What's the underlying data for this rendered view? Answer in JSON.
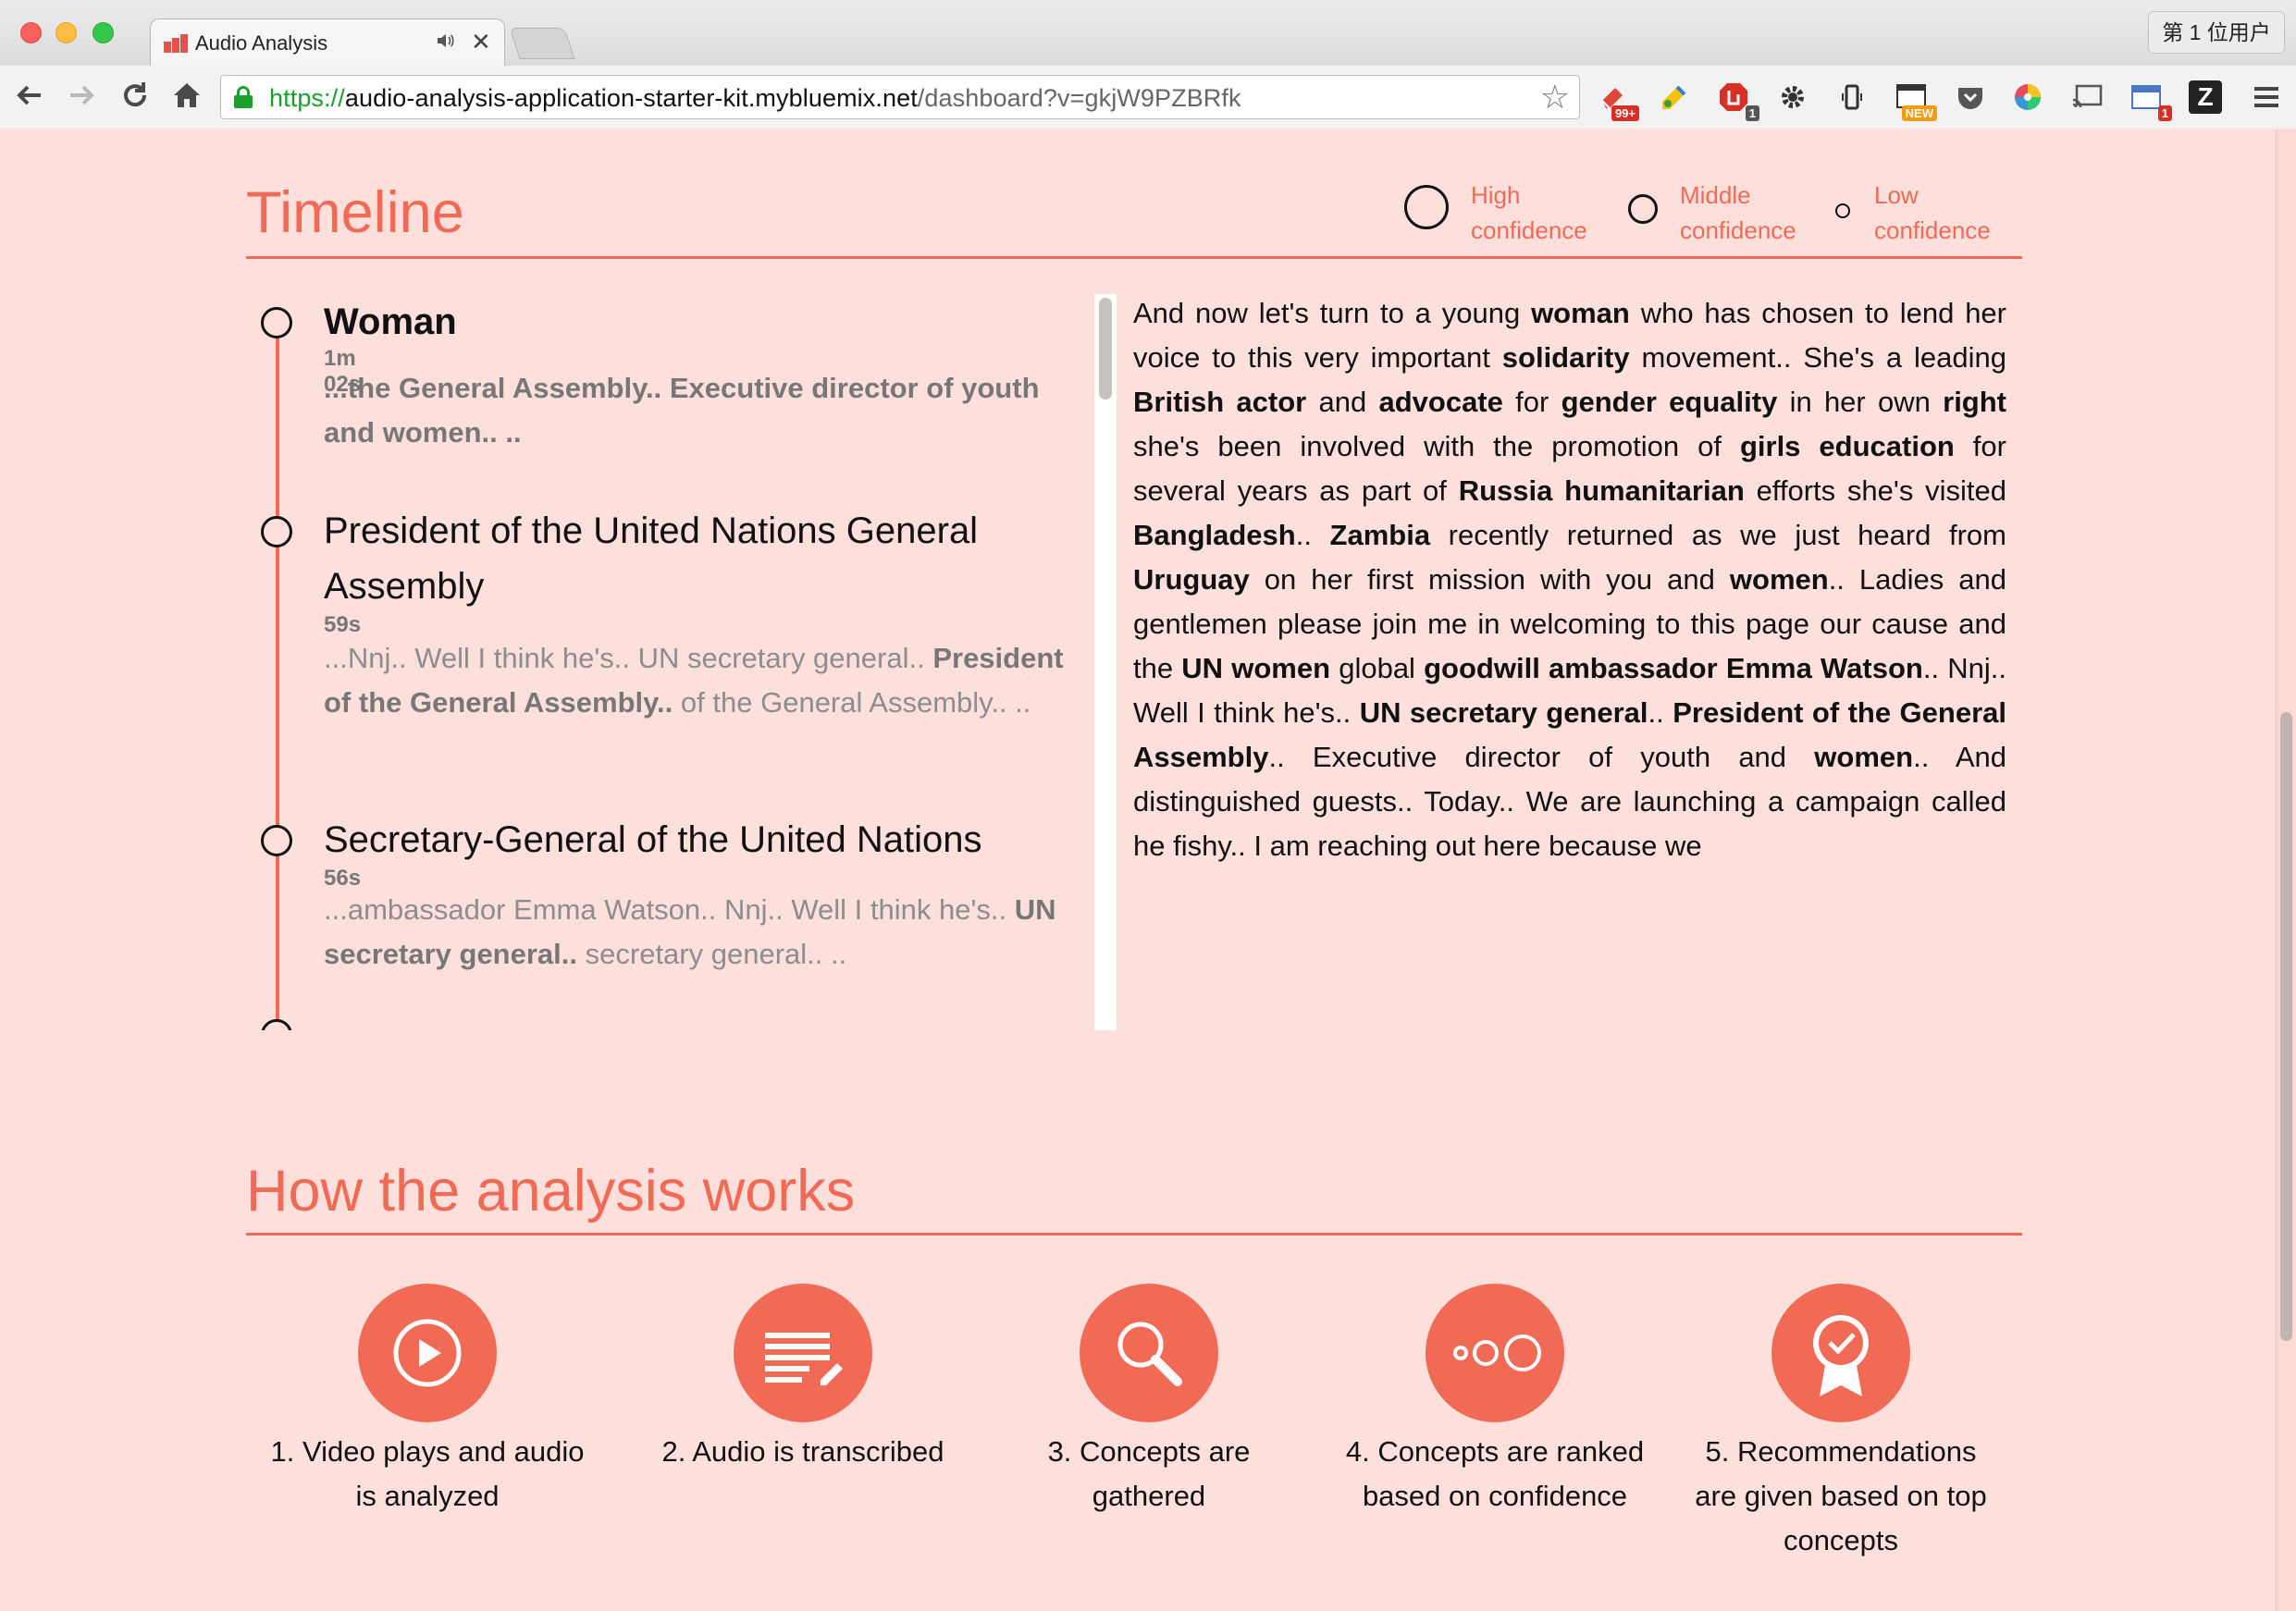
{
  "browser": {
    "tab_title": "Audio Analysis",
    "tab_audio_icon": "speaker-icon",
    "tab_close": "✕",
    "profile_label": "第 1 位用户",
    "url": {
      "scheme": "https://",
      "host": "audio-analysis-application-starter-kit.mybluemix.net",
      "path": "/dashboard?v=gkjW9PZBRfk"
    },
    "extensions": [
      {
        "name": "eraser-extension-icon",
        "badge": "99+"
      },
      {
        "name": "pencil-extension-icon",
        "badge": ""
      },
      {
        "name": "adblock-extension-icon",
        "badge": "1"
      },
      {
        "name": "gear-extension-icon",
        "badge": ""
      },
      {
        "name": "phone-extension-icon",
        "badge": ""
      },
      {
        "name": "window-extension-icon",
        "badge": "NEW"
      },
      {
        "name": "pocket-extension-icon",
        "badge": ""
      },
      {
        "name": "color-wheel-extension-icon",
        "badge": ""
      },
      {
        "name": "cast-extension-icon",
        "badge": ""
      },
      {
        "name": "calendar-extension-icon",
        "badge": "1"
      },
      {
        "name": "z-extension-icon",
        "badge": ""
      },
      {
        "name": "menu-icon",
        "badge": ""
      }
    ]
  },
  "timeline": {
    "title": "Timeline",
    "legend": [
      {
        "label": "High confidence"
      },
      {
        "label": "Middle confidence"
      },
      {
        "label": "Low confidence"
      }
    ],
    "entries": [
      {
        "heading": "Woman",
        "duration": "1m 02s",
        "snippet": "...the General Assembly.. Executive director of youth and women.. .."
      },
      {
        "heading": "President of the United Nations General Assembly",
        "duration": "59s",
        "snippet_plain_1": "...Nnj.. Well I think he's.. UN secretary general..",
        "snippet_bold": "President of the General Assembly..",
        "snippet_plain_2": "of the General Assembly.. .."
      },
      {
        "heading": "Secretary-General of the United Nations",
        "duration": "56s",
        "snippet_plain_1": "...ambassador Emma Watson.. Nnj.. Well I think he's..",
        "snippet_bold": "UN secretary general..",
        "snippet_plain_2": "secretary general.. .."
      }
    ]
  },
  "transcript": [
    {
      "t": "And now let's turn to a young ",
      "b": false
    },
    {
      "t": "woman",
      "b": true
    },
    {
      "t": " who has chosen to lend her voice to this very important ",
      "b": false
    },
    {
      "t": "solidarity",
      "b": true
    },
    {
      "t": " movement.. She's a leading ",
      "b": false
    },
    {
      "t": "British actor",
      "b": true
    },
    {
      "t": " and ",
      "b": false
    },
    {
      "t": "advocate",
      "b": true
    },
    {
      "t": " for ",
      "b": false
    },
    {
      "t": "gender equality",
      "b": true
    },
    {
      "t": " in her own ",
      "b": false
    },
    {
      "t": "right",
      "b": true
    },
    {
      "t": " she's been involved with the promotion of ",
      "b": false
    },
    {
      "t": "girls education",
      "b": true
    },
    {
      "t": " for several years as part of ",
      "b": false
    },
    {
      "t": "Russia humanitarian",
      "b": true
    },
    {
      "t": " efforts she's visited ",
      "b": false
    },
    {
      "t": "Bangladesh",
      "b": true
    },
    {
      "t": ".. ",
      "b": false
    },
    {
      "t": "Zambia",
      "b": true
    },
    {
      "t": " recently returned as we just heard from ",
      "b": false
    },
    {
      "t": "Uruguay",
      "b": true
    },
    {
      "t": " on her first mission with you and ",
      "b": false
    },
    {
      "t": "women",
      "b": true
    },
    {
      "t": ".. Ladies and gentlemen please join me in welcoming to this page our cause and the ",
      "b": false
    },
    {
      "t": "UN women",
      "b": true
    },
    {
      "t": " global ",
      "b": false
    },
    {
      "t": "goodwill ambassador Emma Watson",
      "b": true
    },
    {
      "t": ".. Nnj.. Well I think he's.. ",
      "b": false
    },
    {
      "t": "UN secretary general",
      "b": true
    },
    {
      "t": ".. ",
      "b": false
    },
    {
      "t": "President of the General Assembly",
      "b": true
    },
    {
      "t": ".. Executive director of youth and ",
      "b": false
    },
    {
      "t": "women",
      "b": true
    },
    {
      "t": ".. And distinguished guests.. Today.. We are launching a campaign called he fishy.. I am reaching out here because we",
      "b": false
    }
  ],
  "analysis": {
    "title": "How the analysis works",
    "steps": [
      {
        "icon": "play-icon",
        "label": "1. Video plays and audio is analyzed"
      },
      {
        "icon": "transcript-icon",
        "label": "2. Audio is transcribed"
      },
      {
        "icon": "magnifier-icon",
        "label": "3. Concepts are gathered"
      },
      {
        "icon": "ranked-circles-icon",
        "label": "4. Concepts are ranked based on confidence"
      },
      {
        "icon": "award-ribbon-icon",
        "label": "5. Recommendations are given based on top concepts"
      }
    ]
  },
  "colors": {
    "accent": "#f06a56",
    "page_background": "#fde0dc",
    "text": "#111111",
    "muted_text": "#8d8d8d"
  }
}
